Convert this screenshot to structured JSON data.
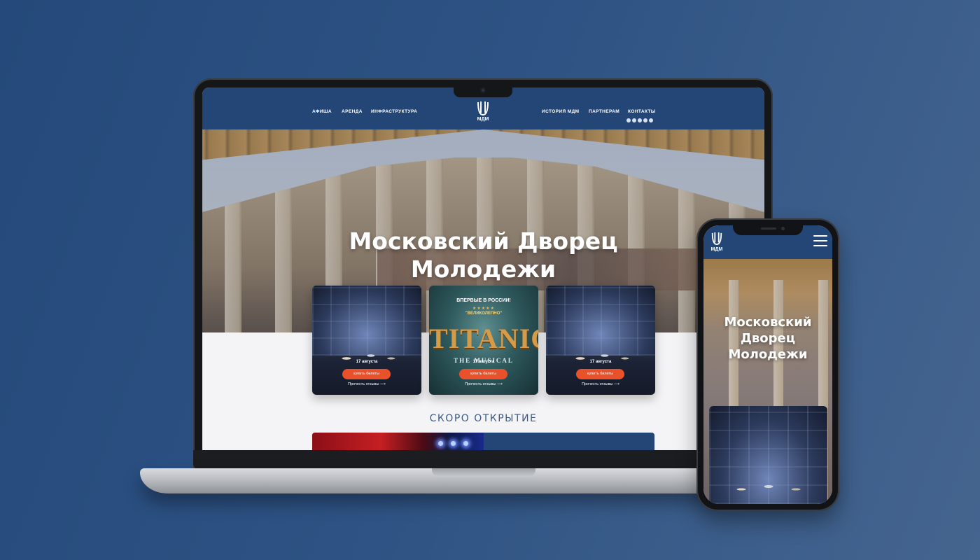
{
  "site": {
    "logo_text": "МДМ",
    "nav_left": [
      "АФИША",
      "АРЕНДА",
      "ИНФРАСТРУКТУРА"
    ],
    "nav_right": [
      "ИСТОРИЯ МДМ",
      "ПАРТНЕРАМ",
      "КОНТАКТЫ"
    ],
    "social_icons": [
      "vk-icon",
      "telegram-icon",
      "youtube-icon",
      "ok-icon",
      "mail-icon"
    ]
  },
  "hero": {
    "title_line1": "Московский Дворец",
    "title_line2": "Молодежи"
  },
  "cards": [
    {
      "date": "17 августа",
      "buy_label": "купить билеты",
      "reviews_label": "Прочесть отзывы ⟶"
    },
    {
      "date": "17 августа",
      "buy_label": "купить билеты",
      "reviews_label": "Прочесть отзывы ⟶",
      "poster": {
        "tag": "ВПЕРВЫЕ В РОССИИ!",
        "stars": "★★★★★",
        "quote": "\"ВЕЛИКОЛЕПНО\"",
        "title": "TITANIC",
        "subtitle": "THE MUSICAL"
      }
    },
    {
      "date": "17 августа",
      "buy_label": "купить билеты",
      "reviews_label": "Прочесть отзывы ⟶"
    }
  ],
  "soon": {
    "title": "СКОРО ОТКРЫТИЕ"
  },
  "mobile": {
    "logo_text": "МДМ",
    "title_line1": "Московский",
    "title_line2": "Дворец",
    "title_line3": "Молодежи"
  },
  "colors": {
    "brand_blue": "#234676",
    "accent_orange": "#e8512a",
    "background": "#2d5283"
  }
}
